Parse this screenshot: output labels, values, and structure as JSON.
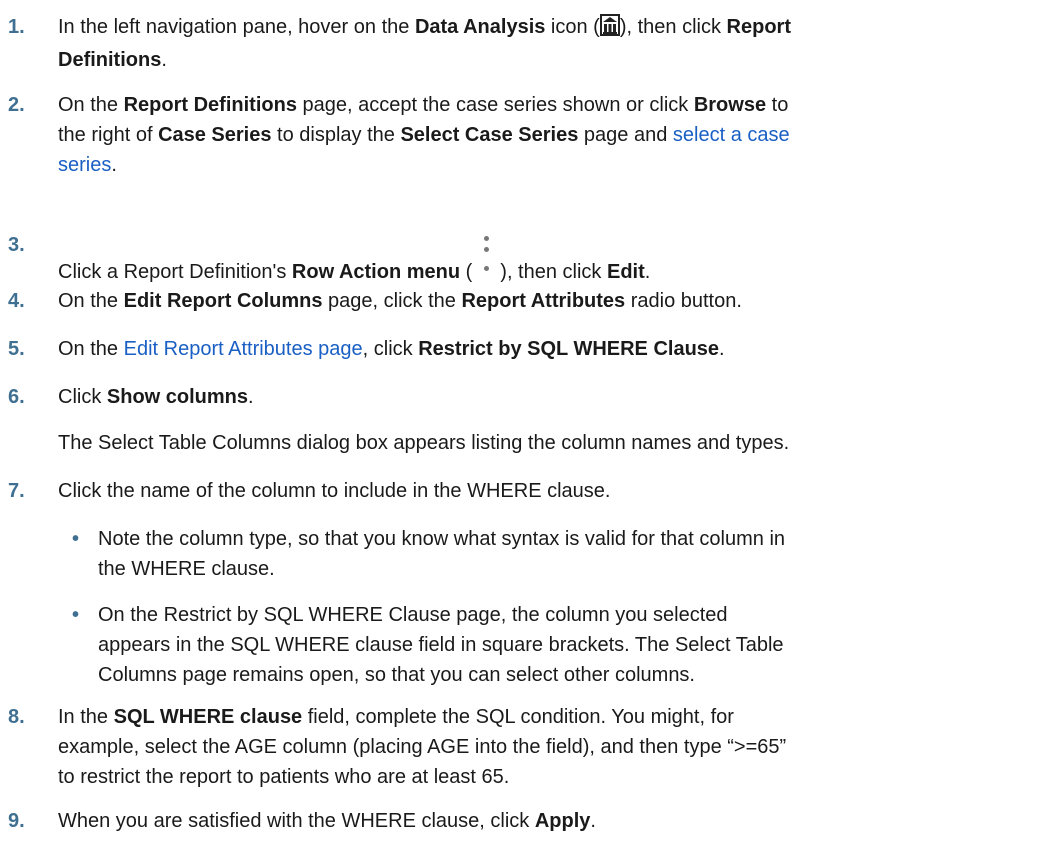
{
  "steps": [
    {
      "num": "1.",
      "t1": "In the left navigation pane, hover on the ",
      "b1": "Data Analysis",
      "t2": " icon (",
      "t3": "), then click ",
      "b2": "Report",
      "b3": "Definitions",
      "t4": "."
    },
    {
      "num": "2.",
      "t1": "On the ",
      "b1": "Report Definitions",
      "t2": " page, accept the case series shown or click ",
      "b2": "Browse",
      "t3": " to",
      "t4": "the right of ",
      "b3": "Case Series",
      "t5": " to display the ",
      "b4": "Select Case Series",
      "t6": " page and ",
      "l1": "select a case",
      "l2": "series",
      "t7": "."
    },
    {
      "num": "3.",
      "t1": "Click a Report Definition's ",
      "b1": "Row Action menu",
      "t2": " (",
      "t3": "), then click ",
      "b2": "Edit",
      "t4": "."
    },
    {
      "num": "4.",
      "t1": "On the ",
      "b1": "Edit Report Columns",
      "t2": " page, click the ",
      "b2": "Report Attributes",
      "t3": " radio button."
    },
    {
      "num": "5.",
      "t1": "On the ",
      "l1": "Edit Report Attributes page",
      "t2": ", click ",
      "b1": "Restrict by SQL WHERE Clause",
      "t3": "."
    },
    {
      "num": "6.",
      "t1": "Click ",
      "b1": "Show columns",
      "t2": ".",
      "note": "The Select Table Columns dialog box appears listing the column names and types."
    },
    {
      "num": "7.",
      "t1": "Click the name of the column to include in the WHERE clause.",
      "bullets": [
        {
          "dot": "•",
          "lines": [
            "Note the column type, so that you know what syntax is valid for that column in",
            "the WHERE clause."
          ]
        },
        {
          "dot": "•",
          "lines": [
            "On the Restrict by SQL WHERE Clause page, the column you selected",
            "appears in the SQL WHERE clause field in square brackets. The Select Table",
            "Columns page remains open, so that you can select other columns."
          ]
        }
      ]
    },
    {
      "num": "8.",
      "t1": "In the ",
      "b1": "SQL WHERE clause",
      "t2": " field, complete the SQL condition. You might, for",
      "line2": "example, select the AGE column (placing AGE into the field), and then type “>=65”",
      "line3": "to restrict the report to patients who are at least 65."
    },
    {
      "num": "9.",
      "t1": "When you are satisfied with the WHERE clause, click ",
      "b1": "Apply",
      "t2": "."
    }
  ],
  "icons": {
    "data_analysis": "data-analysis-icon",
    "row_action": "kebab-menu-icon"
  },
  "colors": {
    "number": "#3f6f91",
    "link": "#1a5fc4",
    "text": "#1a1a1a"
  }
}
